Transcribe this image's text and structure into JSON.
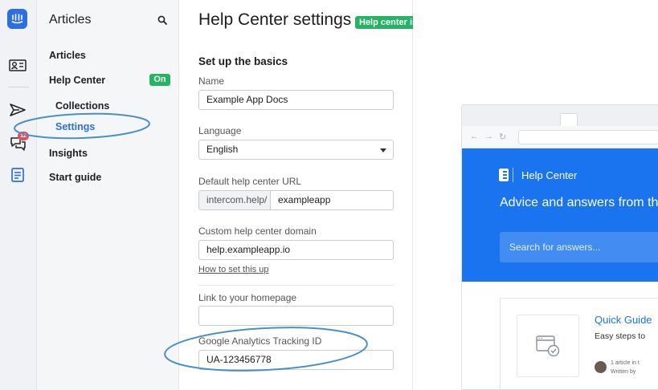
{
  "rail": {
    "icons": [
      "intercom-logo-icon",
      "contacts-icon",
      "send-icon",
      "conversations-icon",
      "articles-icon"
    ],
    "badge_count": "12"
  },
  "nav": {
    "title": "Articles",
    "items": {
      "articles": "Articles",
      "help_center": "Help Center",
      "help_center_badge": "On",
      "collections": "Collections",
      "settings": "Settings",
      "insights": "Insights",
      "start_guide": "Start guide"
    }
  },
  "main": {
    "title": "Help Center settings",
    "status_badge": "Help center is on",
    "section_title": "Set up the basics",
    "fields": {
      "name_label": "Name",
      "name_value": "Example App Docs",
      "language_label": "Language",
      "language_value": "English",
      "url_label": "Default help center URL",
      "url_prefix": "intercom.help/",
      "url_value": "exampleapp",
      "domain_label": "Custom help center domain",
      "domain_value": "help.exampleapp.io",
      "domain_help_link": "How to set this up",
      "homepage_label": "Link to your homepage",
      "homepage_value": "",
      "ga_label": "Google Analytics Tracking ID",
      "ga_value": "UA-123456778"
    }
  },
  "preview": {
    "brand": "Help Center",
    "headline": "Advice and answers from the Team",
    "search_placeholder": "Search for answers...",
    "card": {
      "title": "Quick Guide",
      "description": "Easy steps to",
      "meta_line1": "1 article in t",
      "meta_line2": "Written by"
    }
  },
  "colors": {
    "accent": "#2d6ee6",
    "status_green": "#25b365",
    "hero_blue": "#1a74f0",
    "annotation": "#4a90c8"
  }
}
